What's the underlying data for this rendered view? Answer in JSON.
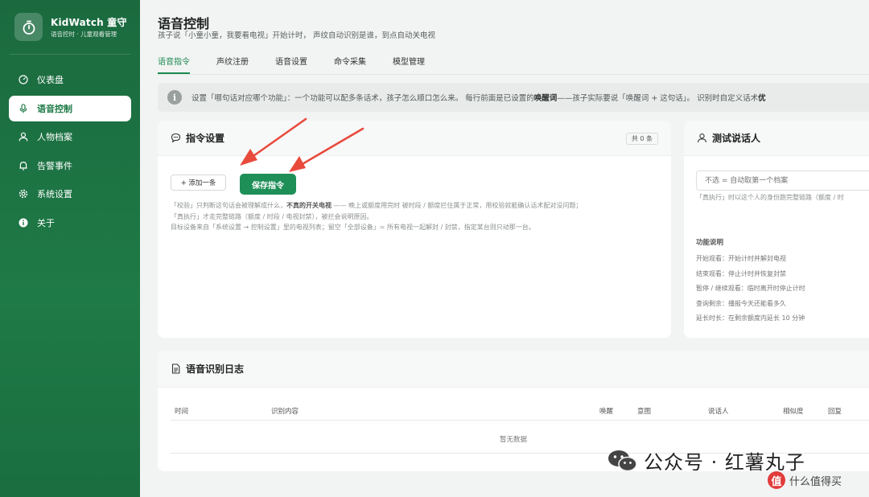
{
  "brand": {
    "title": "KidWatch 童守",
    "subtitle": "语音控时 · 儿童观看管理"
  },
  "sidebar": {
    "items": [
      {
        "label": "仪表盘",
        "icon": "dashboard-icon"
      },
      {
        "label": "语音控制",
        "icon": "microphone-icon",
        "active": true
      },
      {
        "label": "人物档案",
        "icon": "user-icon"
      },
      {
        "label": "告警事件",
        "icon": "bell-icon"
      },
      {
        "label": "系统设置",
        "icon": "gear-icon"
      },
      {
        "label": "关于",
        "icon": "info-icon"
      }
    ]
  },
  "page": {
    "title": "语音控制",
    "subtitle": "孩子说「小童小童，我要看电视」开始计时， 声纹自动识别是谁，到点自动关电视"
  },
  "tabs": [
    {
      "label": "语音指令",
      "active": true
    },
    {
      "label": "声纹注册"
    },
    {
      "label": "语音设置"
    },
    {
      "label": "命令采集"
    },
    {
      "label": "模型管理"
    }
  ],
  "info": {
    "part1": "设置「哪句话对应哪个功能」：一个功能可以配多条话术，孩子怎么顺口怎么来。 每行前面是已设置的",
    "wake_word": "唤醒词",
    "part2": "——孩子实际要说「唤醒词 + 这句话」。 识别时自定义话术",
    "tail": "优"
  },
  "command_card": {
    "title": "指令设置",
    "count": "共 0 条",
    "add_button": "+ 添加一条",
    "save_button": "保存指令",
    "help_line1_a": "「校验」只判断这句话会被理解成什么，",
    "help_line1_b": "不真的开关电视",
    "help_line1_c": " —— 晚上或额度用完时 被时段 / 额度拦住属于正常，用校验就能确认话术配对没问题；",
    "help_line2": "「真执行」才走完整链路（额度 / 时段 / 电视封禁），被拦会说明原因。",
    "help_line3": "目标设备来自「系统设置 → 控制设置」里的电视列表；留空「全部设备」= 所有电视一起解封 / 封禁，指定某台则只动那一台。"
  },
  "speaker_card": {
    "title": "测试说话人",
    "input_placeholder": "不选 = 自动取第一个档案",
    "help": "「真执行」时以这个人的身份跑完整链路（额度 / 时",
    "func_title": "功能说明",
    "functions": [
      "开始观看：开始计时并解封电视",
      "结束观看：停止计时并恢复封禁",
      "暂停 / 继续观看：临时离开时停止计时",
      "查询剩余：播报今天还能看多久",
      "延长时长：在剩余额度内延长 10 分钟"
    ]
  },
  "log_card": {
    "title": "语音识别日志",
    "columns": [
      "时间",
      "识别内容",
      "唤醒",
      "意图",
      "说话人",
      "相似度",
      "回复"
    ],
    "empty_text": "暂无数据"
  },
  "watermark": {
    "main": "公众号 · 红薯丸子",
    "badge": "值",
    "secondary": "什么值得买"
  }
}
